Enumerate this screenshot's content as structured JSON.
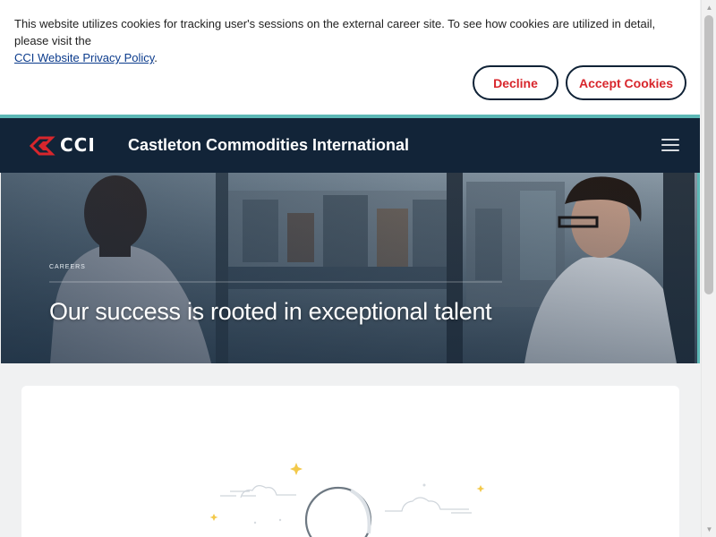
{
  "cookie_banner": {
    "message": "This website utilizes cookies for tracking user's sessions on the external career site. To see how cookies are utilized in detail, please visit the",
    "link_text": "CCI Website Privacy Policy",
    "link_suffix": ".",
    "decline_label": "Decline",
    "accept_label": "Accept Cookies"
  },
  "header": {
    "logo_text": "CCI",
    "title": "Castleton Commodities International"
  },
  "hero": {
    "eyebrow": "CAREERS",
    "title": "Our success is rooted in exceptional talent"
  },
  "colors": {
    "navy": "#122438",
    "accent_teal": "#5db8b6",
    "brand_red": "#d8262c",
    "link_blue": "#0b3b8c"
  },
  "icons": {
    "menu": "hamburger-menu-icon",
    "logo_mark": "chevron-diamond-logo-icon",
    "card_illustration": "empty-state-illustration"
  }
}
